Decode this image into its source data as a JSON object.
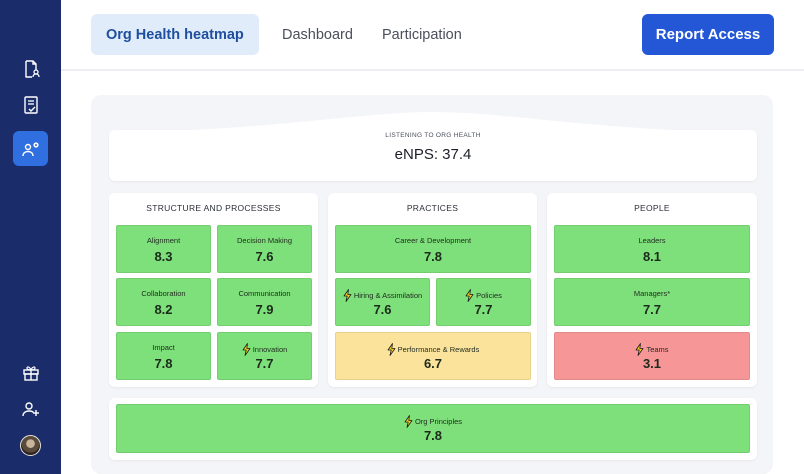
{
  "sidebar": {
    "items": [
      {
        "icon": "document-user-icon"
      },
      {
        "icon": "checklist-icon"
      },
      {
        "icon": "user-settings-icon",
        "active": true
      },
      {
        "icon": "gift-icon"
      },
      {
        "icon": "add-user-icon"
      }
    ]
  },
  "tabs": [
    {
      "label": "Org Health heatmap",
      "active": true
    },
    {
      "label": "Dashboard"
    },
    {
      "label": "Participation"
    }
  ],
  "report_button": {
    "label": "Report Access"
  },
  "enps": {
    "caption": "LISTENING TO ORG HEALTH",
    "value": "eNPS: 37.4"
  },
  "groups": {
    "structure": {
      "title": "STRUCTURE AND PROCESSES",
      "tiles": [
        {
          "label": "Alignment",
          "value": "8.3",
          "status": "green"
        },
        {
          "label": "Decision Making",
          "value": "7.6",
          "status": "green"
        },
        {
          "label": "Collaboration",
          "value": "8.2",
          "status": "green"
        },
        {
          "label": "Communication",
          "value": "7.9",
          "status": "green"
        },
        {
          "label": "Impact",
          "value": "7.8",
          "status": "green"
        },
        {
          "label": "Innovation",
          "value": "7.7",
          "status": "green",
          "flag": true
        }
      ]
    },
    "practices": {
      "title": "PRACTICES",
      "tiles": [
        {
          "label": "Career & Development",
          "value": "7.8",
          "status": "green"
        },
        {
          "label": "Hiring & Assimilation",
          "value": "7.6",
          "status": "green",
          "flag": true
        },
        {
          "label": "Policies",
          "value": "7.7",
          "status": "green",
          "flag": true
        },
        {
          "label": "Performance & Rewards",
          "value": "6.7",
          "status": "yellow",
          "flag": true
        }
      ]
    },
    "people": {
      "title": "PEOPLE",
      "tiles": [
        {
          "label": "Leaders",
          "value": "8.1",
          "status": "green"
        },
        {
          "label": "Managers*",
          "value": "7.7",
          "status": "green"
        },
        {
          "label": "Teams",
          "value": "3.1",
          "status": "red",
          "flag": true
        }
      ]
    }
  },
  "org_principles": {
    "label": "Org Principles",
    "value": "7.8",
    "status": "green",
    "flag": true
  },
  "colors": {
    "sidebar": "#1b2c6b",
    "accent": "#2457d6",
    "green": "#7ee07a",
    "yellow": "#fbe39b",
    "red": "#f79696"
  }
}
